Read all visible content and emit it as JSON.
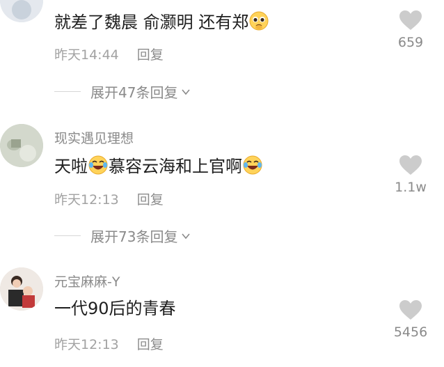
{
  "comments": [
    {
      "username": "",
      "text_before": "就差了魏晨 俞灏明 还有郑",
      "text_middle": "",
      "text_after": "",
      "time": "昨天14:44",
      "reply_label": "回复",
      "likes": "659",
      "expand_label": "展开47条回复"
    },
    {
      "username": "现实遇见理想",
      "text_before": "天啦",
      "text_middle": "慕容云海和上官啊",
      "text_after": "",
      "time": "昨天12:13",
      "reply_label": "回复",
      "likes": "1.1w",
      "expand_label": "展开73条回复"
    },
    {
      "username": "元宝麻麻-Y",
      "text_before": "一代90后的青春",
      "text_middle": "",
      "text_after": "",
      "time": "昨天12:13",
      "reply_label": "回复",
      "likes": "5456",
      "expand_label": ""
    }
  ],
  "icons": {
    "like": "heart-icon",
    "expand": "chevron-down-icon",
    "emoji_pleading": "pleading-face-emoji-icon",
    "emoji_laughing": "laughing-crying-emoji-icon"
  },
  "colors": {
    "heart": "#cccccc",
    "meta_text": "#a2a2a2"
  }
}
